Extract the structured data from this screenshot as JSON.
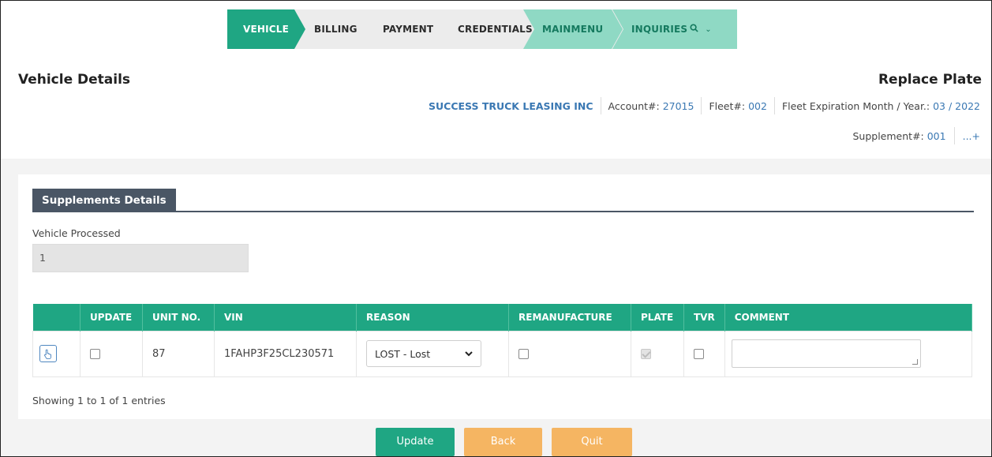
{
  "wizard": {
    "steps": [
      {
        "label": "VEHICLE",
        "state": "active"
      },
      {
        "label": "BILLING",
        "state": "plain"
      },
      {
        "label": "PAYMENT",
        "state": "plain"
      },
      {
        "label": "CREDENTIALS",
        "state": "plain"
      },
      {
        "label": "MAINMENU",
        "state": "light"
      },
      {
        "label": "INQUIRIES",
        "state": "light"
      }
    ]
  },
  "header": {
    "title": "Vehicle Details",
    "action": "Replace Plate",
    "company": "SUCCESS TRUCK LEASING INC",
    "account_label": "Account#:",
    "account_value": "27015",
    "fleet_label": "Fleet#:",
    "fleet_value": "002",
    "expiry_label": "Fleet Expiration Month / Year.:",
    "expiry_value": "03 / 2022",
    "supplement_label": "Supplement#:",
    "supplement_value": "001",
    "more_label": "...+"
  },
  "section": {
    "title": "Supplements Details",
    "vehicle_processed_label": "Vehicle Processed",
    "vehicle_processed_value": "1"
  },
  "table": {
    "columns": [
      "",
      "UPDATE",
      "UNIT NO.",
      "VIN",
      "REASON",
      "REMANUFACTURE",
      "PLATE",
      "TVR",
      "COMMENT"
    ],
    "rows": [
      {
        "update": false,
        "unit_no": "87",
        "vin": "1FAHP3F25CL230571",
        "reason": "LOST - Lost",
        "remanufacture": false,
        "plate": true,
        "tvr": false,
        "comment": ""
      }
    ],
    "footer": "Showing 1 to 1 of 1 entries"
  },
  "buttons": {
    "update": "Update",
    "back": "Back",
    "quit": "Quit"
  },
  "colors": {
    "primary": "#1fa683",
    "primary_light": "#8fd9c4",
    "secondary_button": "#f5b562",
    "section_tab": "#4a5665",
    "link": "#3a78b3"
  }
}
